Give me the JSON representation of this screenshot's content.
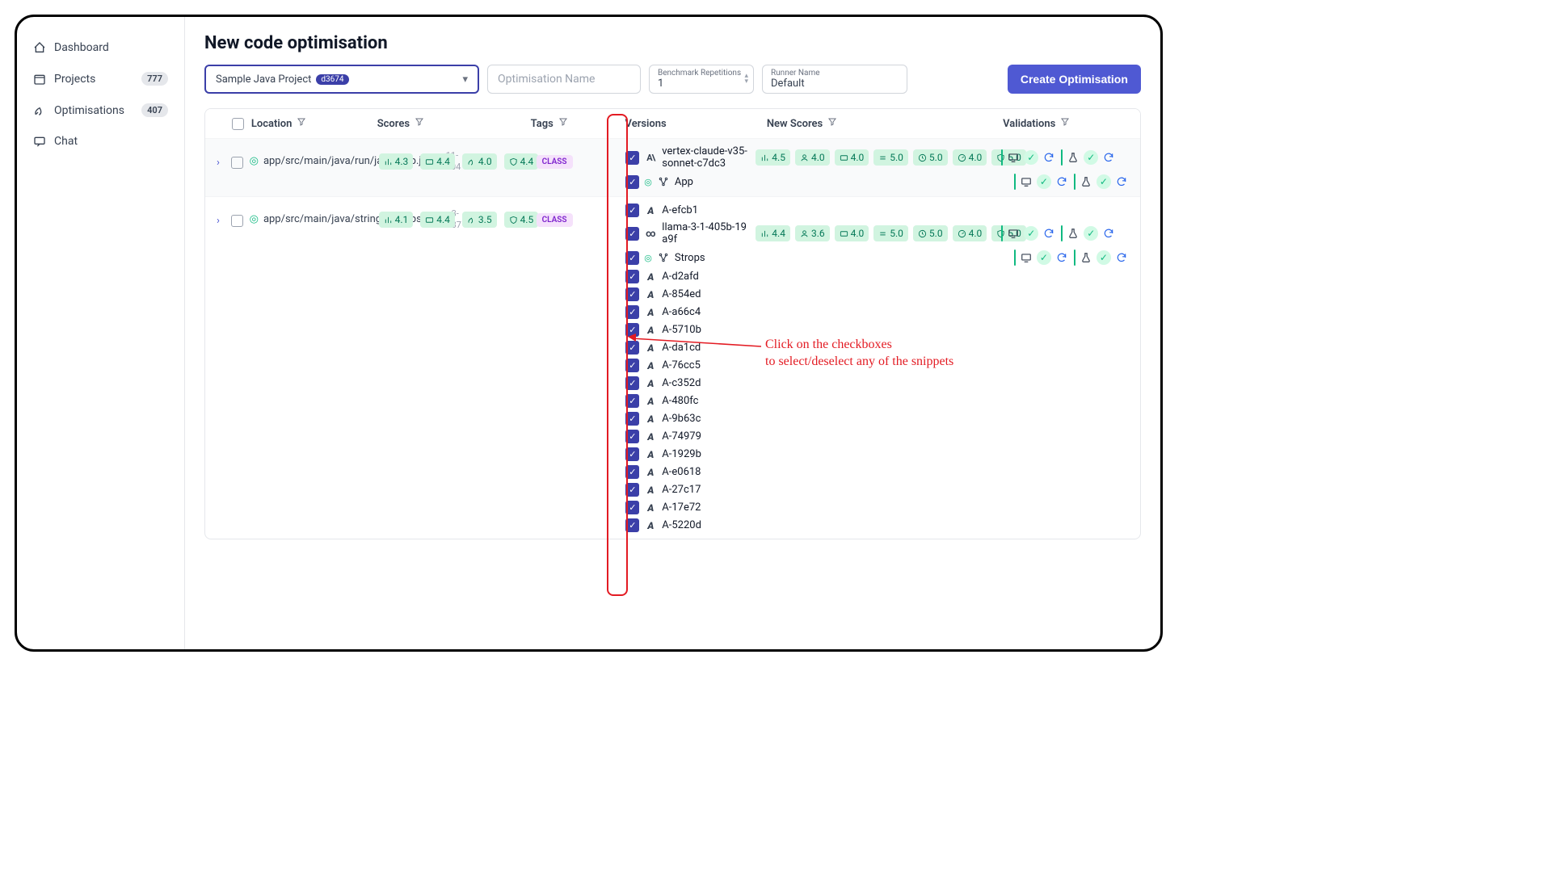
{
  "sidebar": {
    "items": [
      {
        "icon": "home-icon",
        "label": "Dashboard",
        "badge": null
      },
      {
        "icon": "calendar-icon",
        "label": "Projects",
        "badge": "777"
      },
      {
        "icon": "rocket-icon",
        "label": "Optimisations",
        "badge": "407"
      },
      {
        "icon": "chat-icon",
        "label": "Chat",
        "badge": null
      }
    ]
  },
  "page_title": "New code optimisation",
  "toolbar": {
    "project_select": {
      "label": "Sample Java Project",
      "pill": "d3674"
    },
    "opt_name_placeholder": "Optimisation Name",
    "bench_label": "Benchmark Repetitions",
    "bench_value": "1",
    "runner_label": "Runner Name",
    "runner_value": "Default",
    "create_btn": "Create Optimisation"
  },
  "columns": {
    "location": "Location",
    "scores": "Scores",
    "tags": "Tags",
    "versions": "Versions",
    "new_scores": "New Scores",
    "validations": "Validations"
  },
  "rows": [
    {
      "location": "app/src/main/java/run/java/App.java",
      "range": "11-104",
      "scores": [
        "4.3",
        "4.4",
        "4.0",
        "4.4"
      ],
      "score_icons": [
        "bar-icon",
        "card-icon",
        "rocket-icon",
        "shield-icon"
      ],
      "tag": "CLASS",
      "versions": [
        {
          "label": "vertex-claude-v35-sonnet-c7dc3",
          "icon": "anthropic-icon",
          "new_scores": [
            "4.5",
            "4.0",
            "4.0",
            "5.0",
            "5.0",
            "4.0",
            "5.0"
          ],
          "valid": true
        },
        {
          "label": "App",
          "icon": "node-icon",
          "success": true,
          "valid": true
        }
      ]
    },
    {
      "location": "app/src/main/java/strings/Strops.java",
      "range": "3-37",
      "scores": [
        "4.1",
        "4.4",
        "3.5",
        "4.5"
      ],
      "score_icons": [
        "bar-icon",
        "card-icon",
        "rocket-icon",
        "shield-icon"
      ],
      "tag": "CLASS",
      "versions": [
        {
          "label": "A-efcb1",
          "icon": "artflow-icon"
        },
        {
          "label": "llama-3-1-405b-19a9f",
          "icon": "meta-icon",
          "new_scores": [
            "4.4",
            "3.6",
            "4.0",
            "5.0",
            "5.0",
            "4.0",
            "5.0"
          ],
          "valid": true
        },
        {
          "label": "Strops",
          "icon": "node-icon",
          "success": true,
          "valid": true
        },
        {
          "label": "A-d2afd",
          "icon": "artflow-icon"
        },
        {
          "label": "A-854ed",
          "icon": "artflow-icon"
        },
        {
          "label": "A-a66c4",
          "icon": "artflow-icon"
        },
        {
          "label": "A-5710b",
          "icon": "artflow-icon"
        },
        {
          "label": "A-da1cd",
          "icon": "artflow-icon"
        },
        {
          "label": "A-76cc5",
          "icon": "artflow-icon"
        },
        {
          "label": "A-c352d",
          "icon": "artflow-icon"
        },
        {
          "label": "A-480fc",
          "icon": "artflow-icon"
        },
        {
          "label": "A-9b63c",
          "icon": "artflow-icon"
        },
        {
          "label": "A-74979",
          "icon": "artflow-icon"
        },
        {
          "label": "A-1929b",
          "icon": "artflow-icon"
        },
        {
          "label": "A-e0618",
          "icon": "artflow-icon"
        },
        {
          "label": "A-27c17",
          "icon": "artflow-icon"
        },
        {
          "label": "A-17e72",
          "icon": "artflow-icon"
        },
        {
          "label": "A-5220d",
          "icon": "artflow-icon"
        }
      ]
    }
  ],
  "new_score_icons": [
    "bar-icon",
    "user-icon",
    "card-icon",
    "equals-icon",
    "clock-icon",
    "gauge-icon",
    "shield-icon"
  ],
  "annotation": {
    "line1": "Click on the checkboxes",
    "line2": "to select/deselect any of the snippets"
  }
}
